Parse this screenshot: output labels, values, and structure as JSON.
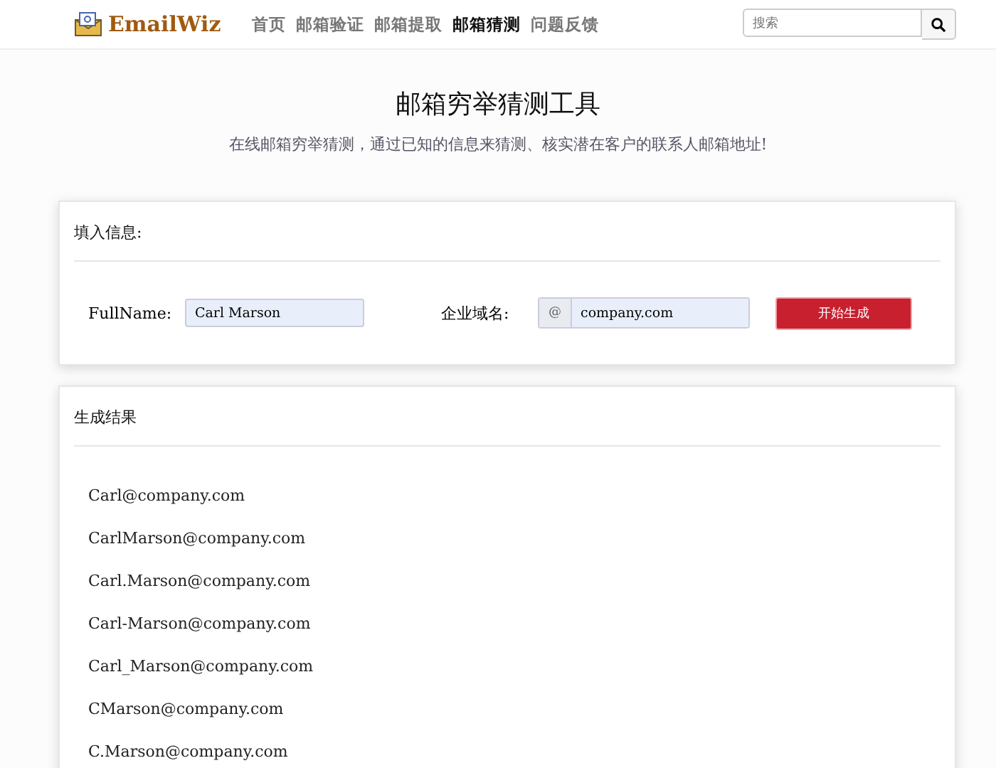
{
  "header": {
    "logo": "EmailWiz",
    "nav": [
      {
        "label": "首页",
        "selected": false
      },
      {
        "label": "邮箱验证",
        "selected": false
      },
      {
        "label": "邮箱提取",
        "selected": false
      },
      {
        "label": "邮箱猜测",
        "selected": true
      },
      {
        "label": "问题反馈",
        "selected": false
      }
    ],
    "search": {
      "placeholder": "搜索"
    }
  },
  "hero": {
    "title": "邮箱穷举猜测工具",
    "subtitle": "在线邮箱穷举猜测，通过已知的信息来猜测、核实潜在客户的联系人邮箱地址!"
  },
  "form": {
    "heading": "填入信息:",
    "fullname_label": "FullName:",
    "fullname_value": "Carl Marson",
    "domain_label": "企业域名:",
    "domain_prefix": "@",
    "domain_value": "company.com",
    "submit": "开始生成"
  },
  "results": {
    "heading": "生成结果",
    "items": [
      "Carl@company.com",
      "CarlMarson@company.com",
      "Carl.Marson@company.com",
      "Carl-Marson@company.com",
      "Carl_Marson@company.com",
      "CMarson@company.com",
      "C.Marson@company.com"
    ]
  }
}
